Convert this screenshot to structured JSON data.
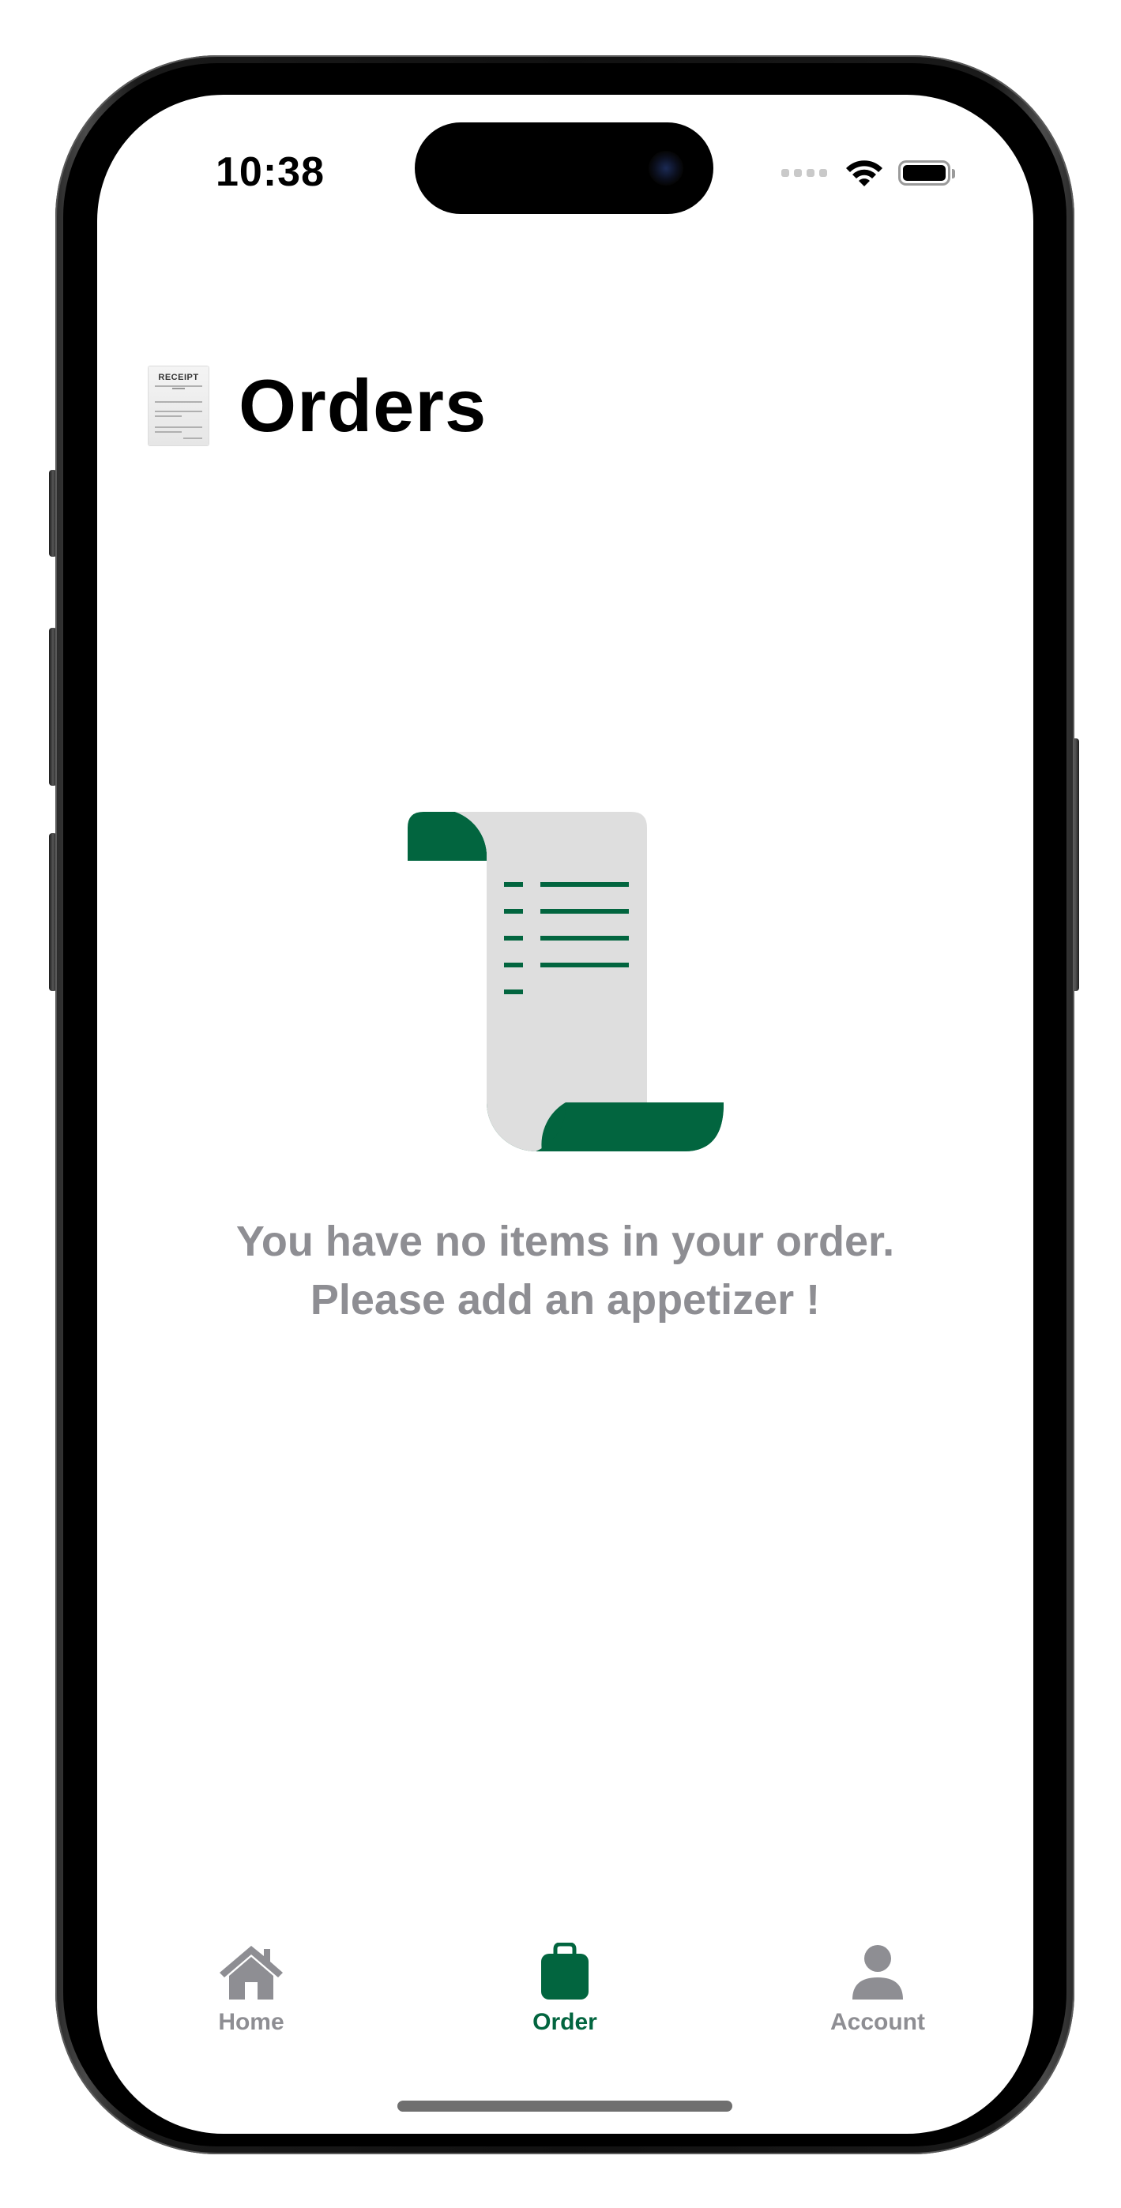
{
  "status_bar": {
    "time": "10:38",
    "icons": [
      "signal-dots-icon",
      "wifi-icon",
      "battery-icon"
    ]
  },
  "header": {
    "title": "Orders",
    "icon": "receipt-icon",
    "icon_text": "RECEIPT"
  },
  "empty_state": {
    "illustration": "scroll-receipt-icon",
    "line1": "You have no items in your order.",
    "line2": "Please add an appetizer !"
  },
  "tab_bar": {
    "tabs": [
      {
        "label": "Home",
        "icon": "house-icon",
        "active": false
      },
      {
        "label": "Order",
        "icon": "bag-icon",
        "active": true
      },
      {
        "label": "Account",
        "icon": "person-icon",
        "active": false
      }
    ]
  },
  "colors": {
    "accent": "#02653f",
    "inactive": "#8e8e93",
    "paper": "#dedede"
  }
}
